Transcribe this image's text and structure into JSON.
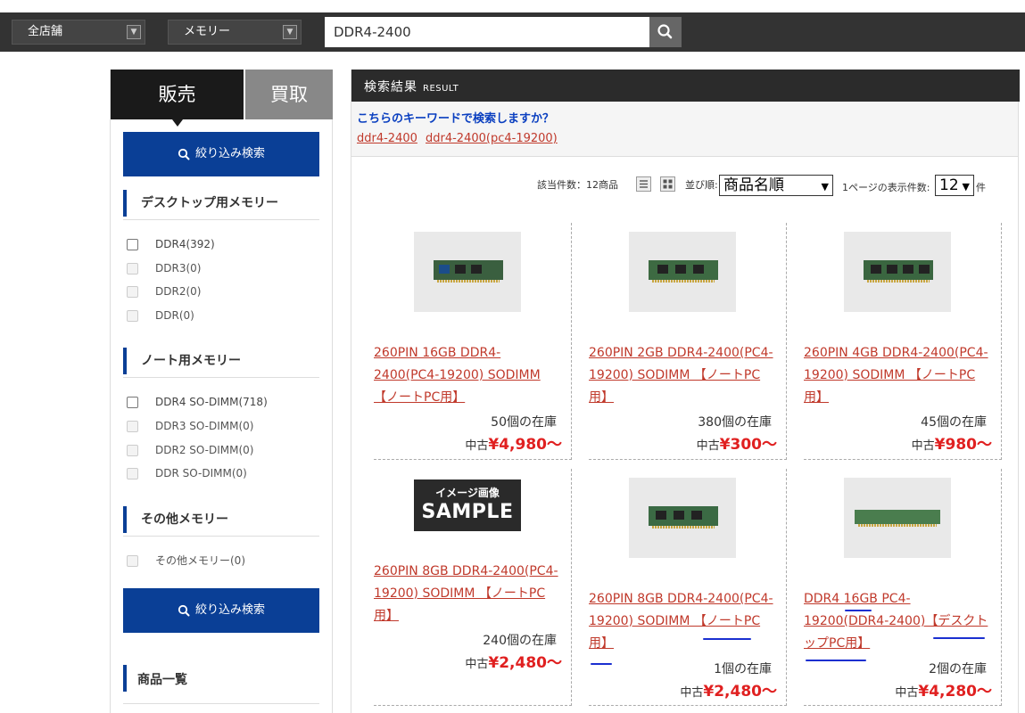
{
  "header": {
    "store_select": "全店舗",
    "category_select": "メモリー",
    "search_value": "DDR4-2400"
  },
  "sidebar": {
    "tab_sell": "販売",
    "tab_buy": "買取",
    "filter_button": "絞り込み検索",
    "groups": [
      {
        "title": "デスクトップ用メモリー",
        "options": [
          {
            "label": "DDR4(392)",
            "enabled": true
          },
          {
            "label": "DDR3(0)",
            "enabled": false
          },
          {
            "label": "DDR2(0)",
            "enabled": false
          },
          {
            "label": "DDR(0)",
            "enabled": false
          }
        ]
      },
      {
        "title": "ノート用メモリー",
        "options": [
          {
            "label": "DDR4 SO-DIMM(718)",
            "enabled": true
          },
          {
            "label": "DDR3 SO-DIMM(0)",
            "enabled": false
          },
          {
            "label": "DDR2 SO-DIMM(0)",
            "enabled": false
          },
          {
            "label": "DDR SO-DIMM(0)",
            "enabled": false
          }
        ]
      },
      {
        "title": "その他メモリー",
        "options": [
          {
            "label": "その他メモリー(0)",
            "enabled": false
          }
        ]
      }
    ],
    "product_list_title": "商品一覧"
  },
  "main": {
    "header_title": "検索結果",
    "header_sub": "RESULT",
    "suggest_question": "こちらのキーワードで検索しますか？",
    "suggest_keywords": [
      "ddr4-2400",
      "ddr4-2400(pc4-19200)"
    ],
    "result_count": "該当件数：12商品",
    "sort_label": "並び順:",
    "sort_value": "商品名順",
    "per_page_label": "1ページの表示件数:",
    "per_page_value": "12",
    "per_page_unit": "件"
  },
  "products": [
    {
      "name_lines": [
        "260PIN 16GB DDR4-",
        "2400(PC4-19200) SODIMM",
        "【ノートPC用】"
      ],
      "stock": "50個の在庫",
      "condition": "中古",
      "price": "¥4,980〜"
    },
    {
      "name_lines": [
        "260PIN 2GB DDR4-2400(PC4-",
        "19200) SODIMM 【ノートPC",
        "用】"
      ],
      "stock": "380個の在庫",
      "condition": "中古",
      "price": "¥300〜"
    },
    {
      "name_lines": [
        "260PIN 4GB DDR4-2400(PC4-",
        "19200) SODIMM 【ノートPC",
        "用】"
      ],
      "stock": "45個の在庫",
      "condition": "中古",
      "price": "¥980〜"
    },
    {
      "name_lines": [
        "260PIN 8GB DDR4-2400(PC4-",
        "19200) SODIMM 【ノートPC",
        "用】"
      ],
      "stock": "240個の在庫",
      "condition": "中古",
      "price": "¥2,480〜",
      "image_text": [
        "イメージ画像",
        "SAMPLE"
      ]
    },
    {
      "name_lines": [
        "260PIN 8GB DDR4-2400(PC4-",
        "19200) SODIMM 【ノートPC",
        "用】"
      ],
      "stock": "1個の在庫",
      "condition": "中古",
      "price": "¥2,480〜"
    },
    {
      "name_lines": [
        "DDR4 16GB PC4-",
        "19200(DDR4-2400)【デスクト",
        "ップPC用】"
      ],
      "stock": "2個の在庫",
      "condition": "中古",
      "price": "¥4,280〜"
    }
  ]
}
